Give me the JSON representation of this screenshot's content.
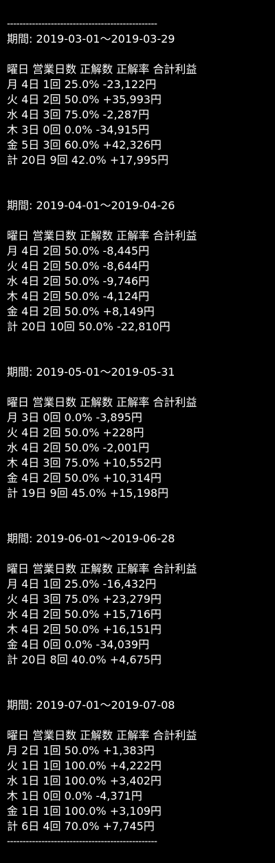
{
  "divider": "------------------------------------------------",
  "period_label": "期間: ",
  "header": "曜日 営業日数 正解数 正解率 合計利益",
  "sections": [
    {
      "period": "2019-03-01～2019-03-29",
      "rows": [
        "月 4日 1回 25.0% -23,122円",
        "火 4日 2回 50.0% +35,993円",
        "水 4日 3回 75.0% -2,287円",
        "木 3日 0回 0.0% -34,915円",
        "金 5日 3回 60.0% +42,326円",
        "計 20日 9回 42.0% +17,995円"
      ]
    },
    {
      "period": "2019-04-01～2019-04-26",
      "rows": [
        "月 4日 2回 50.0% -8,445円",
        "火 4日 2回 50.0% -8,644円",
        "水 4日 2回 50.0% -9,746円",
        "木 4日 2回 50.0% -4,124円",
        "金 4日 2回 50.0% +8,149円",
        "計 20日 10回 50.0% -22,810円"
      ]
    },
    {
      "period": "2019-05-01～2019-05-31",
      "rows": [
        "月 3日 0回 0.0% -3,895円",
        "火 4日 2回 50.0% +228円",
        "水 4日 2回 50.0% -2,001円",
        "木 4日 3回 75.0% +10,552円",
        "金 4日 2回 50.0% +10,314円",
        "計 19日 9回 45.0% +15,198円"
      ]
    },
    {
      "period": "2019-06-01～2019-06-28",
      "rows": [
        "月 4日 1回 25.0% -16,432円",
        "火 4日 3回 75.0% +23,279円",
        "水 4日 2回 50.0% +15,716円",
        "木 4日 2回 50.0% +16,151円",
        "金 4日 0回 0.0% -34,039円",
        "計 20日 8回 40.0% +4,675円"
      ]
    },
    {
      "period": "2019-07-01～2019-07-08",
      "rows": [
        "月 2日 1回 50.0% +1,383円",
        "火 1日 1回 100.0% +4,222円",
        "水 1日 1回 100.0% +3,402円",
        "木 1日 0回 0.0% -4,371円",
        "金 1日 1回 100.0% +3,109円",
        "計 6日 4回 70.0% +7,745円"
      ]
    }
  ]
}
